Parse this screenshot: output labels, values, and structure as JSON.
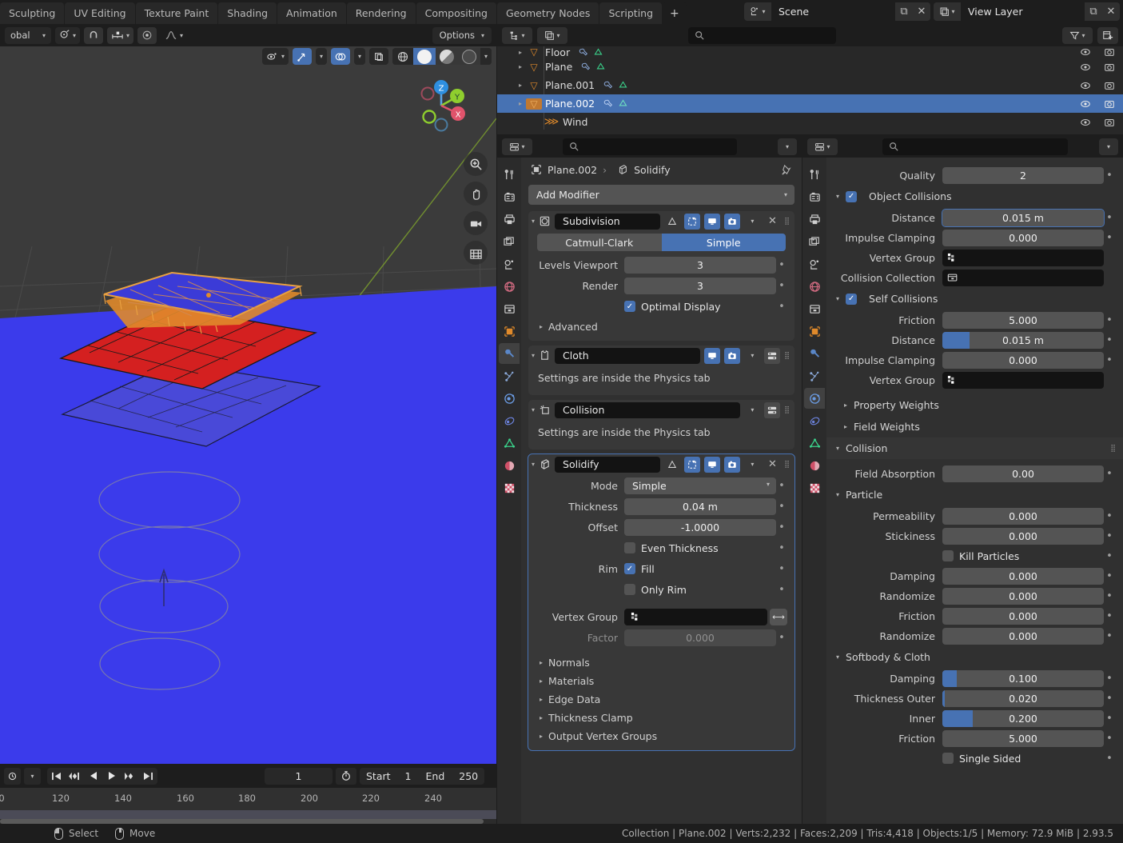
{
  "topbar": {
    "workspace_tabs": [
      "Sculpting",
      "UV Editing",
      "Texture Paint",
      "Shading",
      "Animation",
      "Rendering",
      "Compositing",
      "Geometry Nodes",
      "Scripting"
    ],
    "add_tab": "+",
    "scene": {
      "name": "Scene",
      "icon": "scene-icon",
      "new_label": "⧉",
      "close_label": "✕"
    },
    "view_layer": {
      "name": "View Layer",
      "icon": "viewlayer-icon",
      "new_label": "⧉",
      "close_label": "✕"
    }
  },
  "viewport": {
    "header": {
      "transform_orientation": "obal",
      "options": "Options",
      "pivot_icon": "pivot-icon",
      "snap_magnet_icon": "magnet-icon",
      "snap_icon": "snap-increment-icon",
      "proportional_icon": "proportional-edit-icon",
      "falloff_icon": "falloff-curve-icon",
      "visibility_icon": "visibility-icon",
      "gizmo_icon": "gizmo-icon",
      "overlays_icon": "overlays-icon",
      "xray_icon": "xray-icon",
      "shading_wireframe": "wireframe-shading-icon",
      "shading_solid": "solid-shading-icon",
      "shading_material": "material-preview-icon",
      "shading_rendered": "rendered-shading-icon"
    },
    "gizmo": {
      "axes": [
        "Z",
        "Y",
        "X"
      ],
      "zoom_icon": "zoom-icon",
      "hand_icon": "pan-icon",
      "camera_icon": "camera-icon",
      "grid_icon": "ortho-persp-icon"
    },
    "objects": [
      {
        "name": "Plane.002",
        "state": "selected",
        "color": "#3b3bd7",
        "outline": "#e08a2b"
      },
      {
        "name": "Plane.001",
        "state": "unselected",
        "color": "#d42020"
      },
      {
        "name": "Plane",
        "state": "unselected",
        "color": "#4a4ad0"
      },
      {
        "name": "Floor",
        "state": "unselected",
        "color": "#3838e8"
      },
      {
        "name": "Wind",
        "state": "force-field"
      }
    ]
  },
  "timeline": {
    "current_frame": "1",
    "start_label": "Start",
    "start_value": "1",
    "end_label": "End",
    "end_value": "250",
    "ticks": [
      "0",
      "120",
      "140",
      "160",
      "180",
      "200",
      "220",
      "240"
    ],
    "playback_icons": [
      "jump-start-icon",
      "prev-keyframe-icon",
      "play-reverse-icon",
      "play-icon",
      "next-keyframe-icon",
      "jump-end-icon"
    ],
    "timer_icon": "auto-key-icon",
    "editor_icon": "timeline-editor-icon"
  },
  "outliner": {
    "header": {
      "display_mode_icon": "outliner-display-icon",
      "filter_icon": "filter-icon",
      "new_collection_icon": "new-collection-icon",
      "search_placeholder": ""
    },
    "rows": [
      {
        "name": "Floor",
        "icon": "mesh-icon",
        "indent": 1,
        "selected": false,
        "partial": true,
        "mods": [
          "modifier-icon",
          "mesh-data-icon"
        ]
      },
      {
        "name": "Plane",
        "icon": "mesh-icon",
        "indent": 1,
        "selected": false,
        "mods": [
          "modifier-icon",
          "mesh-data-icon"
        ]
      },
      {
        "name": "Plane.001",
        "icon": "mesh-icon",
        "indent": 1,
        "selected": false,
        "mods": [
          "modifier-icon",
          "mesh-data-icon"
        ]
      },
      {
        "name": "Plane.002",
        "icon": "mesh-icon",
        "indent": 1,
        "selected": true,
        "mods": [
          "modifier-icon",
          "mesh-data-icon"
        ]
      },
      {
        "name": "Wind",
        "icon": "force-field-icon",
        "indent": 1,
        "selected": false,
        "mods": []
      }
    ],
    "visibility_icons": [
      "eye-icon",
      "camera-icon"
    ]
  },
  "modifier_panel": {
    "breadcrumb": {
      "object": "Plane.002",
      "modifier": "Solidify",
      "object_icon": "object-icon",
      "modifier_icon": "solidify-icon",
      "separator": "›",
      "pin_icon": "pin-icon"
    },
    "add_modifier": "Add Modifier",
    "modifiers": [
      {
        "name": "Subdivision",
        "icon": "subsurf-icon",
        "expanded": true,
        "header_toggles": [
          "edit-mode-off",
          "edit-mode-on",
          "realtime-on",
          "render-on"
        ],
        "segmented": {
          "options": [
            "Catmull-Clark",
            "Simple"
          ],
          "selected": "Simple"
        },
        "fields": [
          {
            "label": "Levels Viewport",
            "value": "3"
          },
          {
            "label": "Render",
            "value": "3"
          }
        ],
        "checkboxes": [
          {
            "label": "Optimal Display",
            "checked": true
          }
        ],
        "subpanels": [
          "Advanced"
        ]
      },
      {
        "name": "Cloth",
        "icon": "cloth-icon",
        "expanded": true,
        "header_toggles": [
          "realtime-on",
          "render-on"
        ],
        "note": "Settings are inside the Physics tab"
      },
      {
        "name": "Collision",
        "icon": "collision-icon",
        "expanded": true,
        "header_toggles": [],
        "note": "Settings are inside the Physics tab"
      },
      {
        "name": "Solidify",
        "icon": "solidify-icon",
        "expanded": true,
        "active": true,
        "header_toggles": [
          "edit-mode-off",
          "edit-mode-on",
          "realtime-on",
          "render-on"
        ],
        "fields": [
          {
            "label": "Mode",
            "value": "Simple",
            "type": "dropdown"
          },
          {
            "label": "Thickness",
            "value": "0.04 m"
          },
          {
            "label": "Offset",
            "value": "-1.0000"
          }
        ],
        "checkboxes": [
          {
            "label": "Even Thickness",
            "checked": false,
            "rowlabel": ""
          },
          {
            "label": "Fill",
            "checked": true,
            "rowlabel": "Rim"
          },
          {
            "label": "Only Rim",
            "checked": false,
            "rowlabel": ""
          }
        ],
        "vertex_group": {
          "label": "Vertex Group",
          "value": "",
          "icon": "vertex-group-icon",
          "invert_icon": "invert-icon"
        },
        "factor": {
          "label": "Factor",
          "value": "0.000",
          "disabled": true
        },
        "subpanels": [
          "Normals",
          "Materials",
          "Edge Data",
          "Thickness Clamp",
          "Output Vertex Groups"
        ]
      }
    ]
  },
  "physics_panel": {
    "fields_top": [
      {
        "label": "Quality",
        "value": "2"
      }
    ],
    "sections": [
      {
        "title": "Object Collisions",
        "checkbox": true,
        "checked": true,
        "type": "checkbox-section",
        "fields": [
          {
            "label": "Distance",
            "value": "0.015 m",
            "highlight": true
          },
          {
            "label": "Impulse Clamping",
            "value": "0.000"
          },
          {
            "label": "Vertex Group",
            "value": "",
            "type": "dark",
            "icon": "vertex-group-icon"
          },
          {
            "label": "Collision Collection",
            "value": "",
            "type": "dark",
            "icon": "collection-icon"
          }
        ]
      },
      {
        "title": "Self Collisions",
        "checkbox": true,
        "checked": true,
        "type": "checkbox-section",
        "fields": [
          {
            "label": "Friction",
            "value": "5.000"
          },
          {
            "label": "Distance",
            "value": "0.015 m",
            "slider": 0.17
          },
          {
            "label": "Impulse Clamping",
            "value": "0.000"
          },
          {
            "label": "Vertex Group",
            "value": "",
            "type": "dark",
            "icon": "vertex-group-icon"
          }
        ]
      }
    ],
    "collapsed": [
      "Property Weights",
      "Field Weights"
    ],
    "collision_header": "Collision",
    "collision_fields": [
      {
        "label": "Field Absorption",
        "value": "0.00"
      }
    ],
    "particle_header": "Particle",
    "particle_fields": [
      {
        "label": "Permeability",
        "value": "0.000"
      },
      {
        "label": "Stickiness",
        "value": "0.000"
      },
      {
        "label": "Kill Particles",
        "value": "",
        "checkbox": true,
        "checked": false
      },
      {
        "label": "Damping",
        "value": "0.000"
      },
      {
        "label": "Randomize",
        "value": "0.000"
      },
      {
        "label": "Friction",
        "value": "0.000"
      },
      {
        "label": "Randomize",
        "value": "0.000"
      }
    ],
    "softbody_header": "Softbody & Cloth",
    "softbody_fields": [
      {
        "label": "Damping",
        "value": "0.100",
        "slider": 0.09
      },
      {
        "label": "Thickness Outer",
        "value": "0.020",
        "slider": 0.012
      },
      {
        "label": "Inner",
        "value": "0.200",
        "slider": 0.19
      },
      {
        "label": "Friction",
        "value": "5.000"
      },
      {
        "label": "Single Sided",
        "value": "",
        "checkbox": true,
        "checked": false
      }
    ]
  },
  "statusbar": {
    "left": [
      {
        "icon": "mouse-left-icon",
        "label": "Select"
      },
      {
        "icon": "mouse-middle-icon",
        "label": "Move"
      }
    ],
    "right": "Collection | Plane.002 | Verts:2,232 | Faces:2,209 | Tris:4,418 | Objects:1/5 | Memory: 72.9 MiB | 2.93.5"
  },
  "colors": {
    "accent": "#4772b3",
    "selected_outline": "#e08a2b",
    "panel": "#303030",
    "header": "#1d1d1d"
  }
}
